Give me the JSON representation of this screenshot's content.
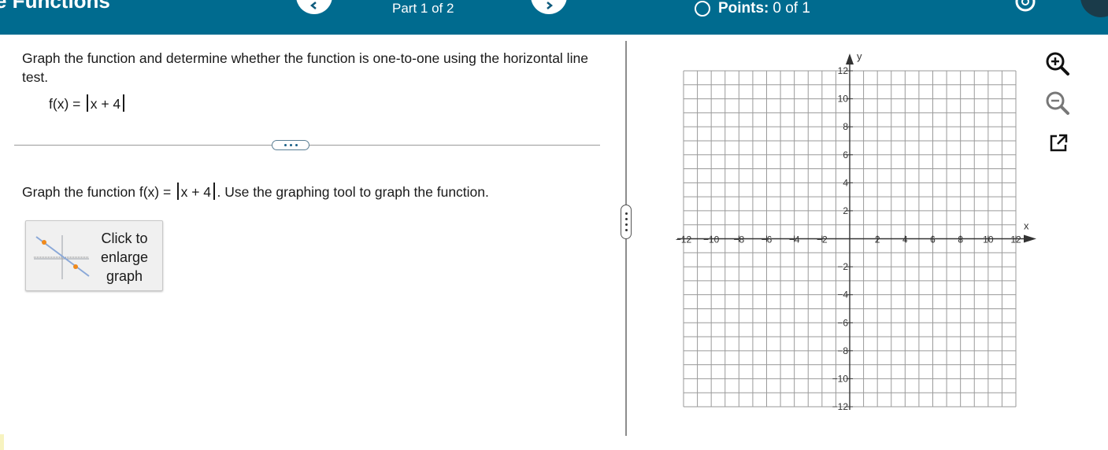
{
  "header": {
    "title": "e Functions",
    "part_label": "Part 1 of 2",
    "points_label": "Points:",
    "points_value": "0 of 1"
  },
  "problem": {
    "instruction": "Graph the function and determine whether the function is one-to-one using the horizontal line test.",
    "fx_lhs": "f(x) =",
    "fx_inner": "x + 4",
    "part_prompt_pre": "Graph the function f(x) =",
    "part_prompt_inner": "x + 4",
    "part_prompt_post": ". Use the graphing tool to graph the function.",
    "enlarge_label": "Click to enlarge graph"
  },
  "graph": {
    "x_label": "x",
    "y_label": "y",
    "x_min": -12,
    "x_max": 12,
    "y_min": -12,
    "y_max": 12,
    "grid_step": 1,
    "label_step": 2,
    "grid": true
  },
  "icons": {
    "gear": "gear-icon",
    "zoom_in": "zoom-in-icon",
    "zoom_out": "zoom-out-icon",
    "popout": "popout-icon"
  },
  "colors": {
    "header_bg": "#006b8f",
    "grid_line": "#9a9a9a",
    "axis": "#333333",
    "thumb_point": "#f08a1c",
    "thumb_line": "#8aa8d8"
  }
}
